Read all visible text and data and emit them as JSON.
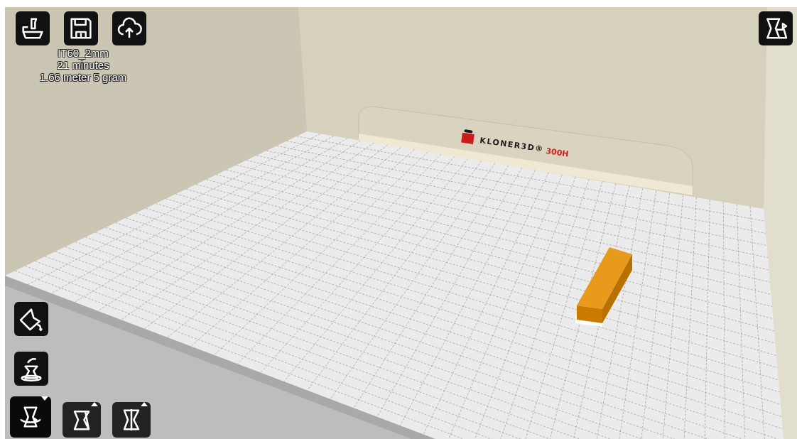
{
  "print_info": {
    "profile": "IT60_2mm",
    "time": "21 minutes",
    "material": "1.66 meter 5 gram"
  },
  "printer_logo": {
    "brand": "KLONER3D®",
    "model": "300H"
  },
  "top_tools": [
    {
      "kind": "print"
    },
    {
      "kind": "save"
    },
    {
      "kind": "upload"
    }
  ],
  "view_tool": {
    "kind": "view-mode"
  },
  "side_tools": [
    {
      "kind": "lay-flat"
    },
    {
      "kind": "reset-rotation"
    }
  ],
  "transform_tools": [
    {
      "kind": "rotate",
      "selected": true
    },
    {
      "kind": "scale",
      "selected": false
    },
    {
      "kind": "mirror",
      "selected": false
    }
  ]
}
